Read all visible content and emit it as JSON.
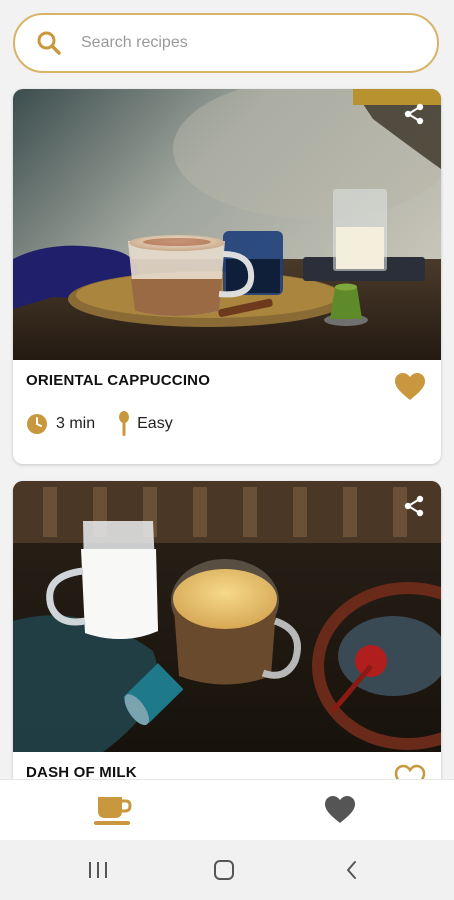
{
  "search": {
    "placeholder": "Search recipes",
    "icon": "search-icon"
  },
  "recipes": [
    {
      "title": "ORIENTAL CAPPUCCINO",
      "time": "3 min",
      "difficulty": "Easy"
    },
    {
      "title": "DASH OF MILK"
    }
  ],
  "bottom_nav": {
    "tabs": [
      "coffee-cup-icon",
      "heart-icon"
    ],
    "active": "coffee-cup-icon"
  },
  "system_nav": [
    "recent-apps-icon",
    "home-icon",
    "back-icon"
  ],
  "colors": {
    "accent": "#c9973d",
    "search_border": "#d9b36a",
    "inactive_icon": "#555555"
  }
}
